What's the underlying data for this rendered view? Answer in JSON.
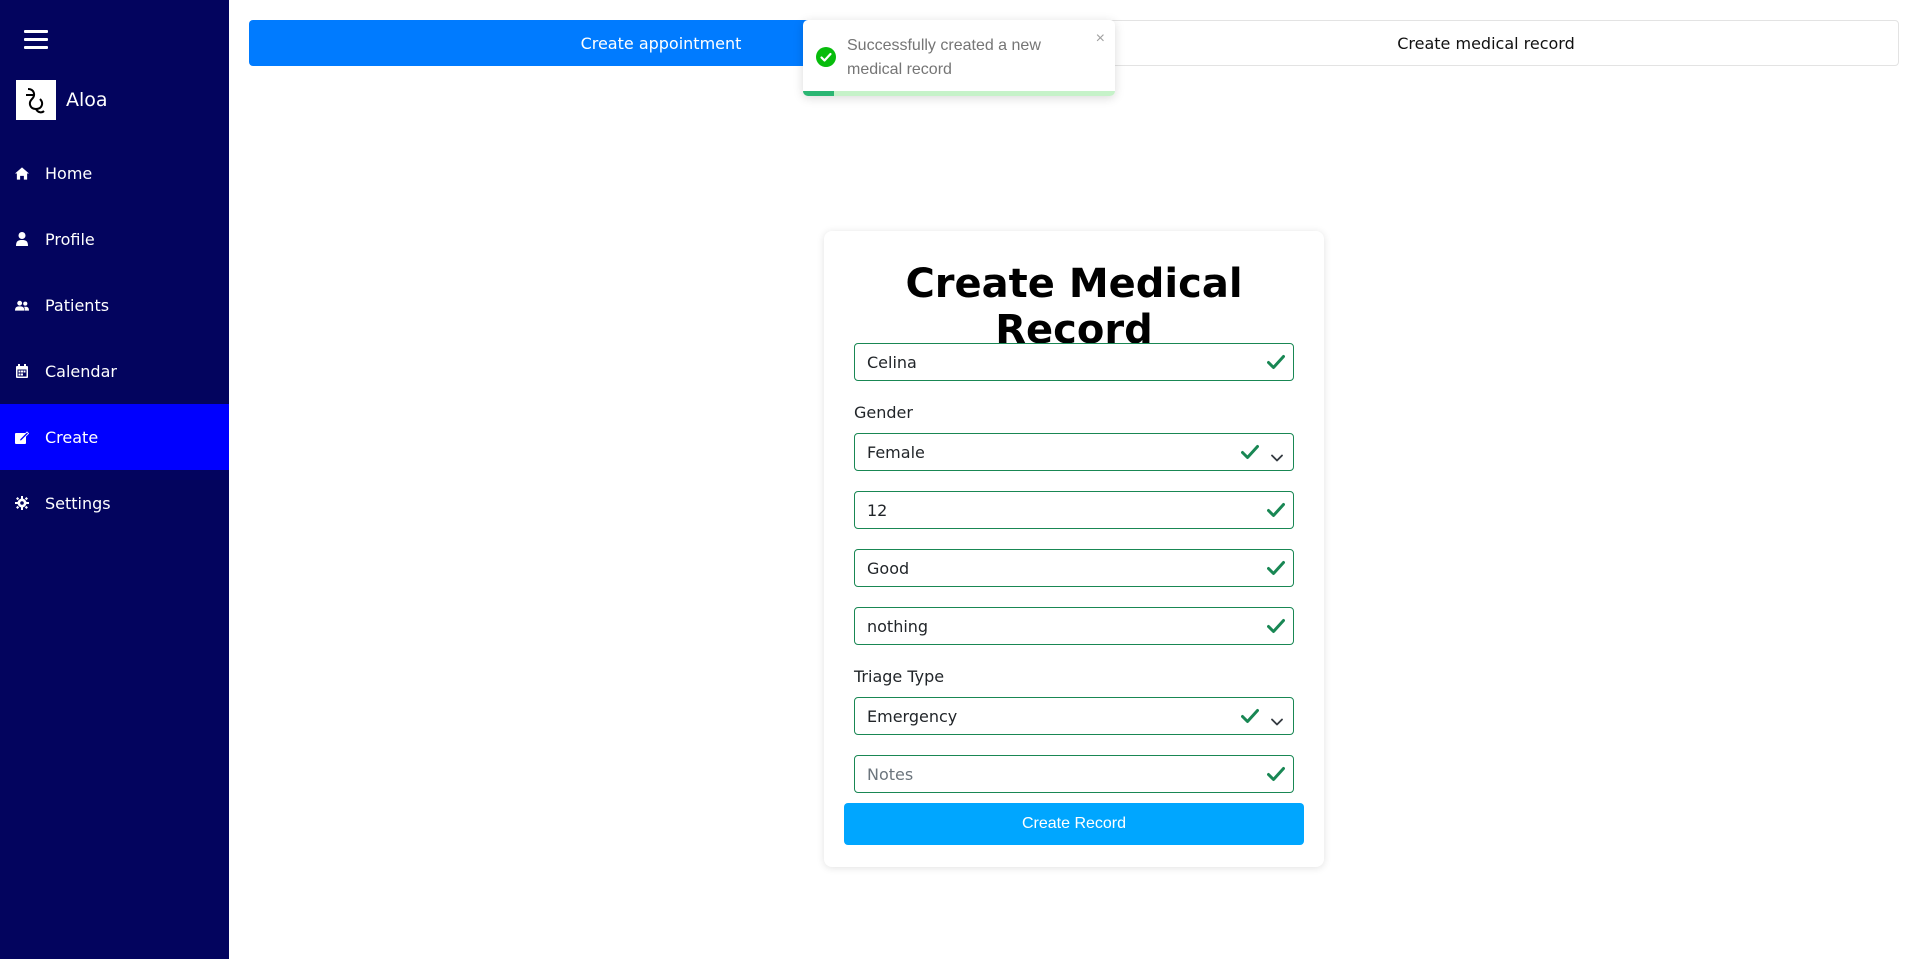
{
  "app": {
    "name": "Aloa"
  },
  "sidebar": {
    "items": [
      {
        "label": "Home",
        "icon": "home-icon"
      },
      {
        "label": "Profile",
        "icon": "user-icon"
      },
      {
        "label": "Patients",
        "icon": "users-icon"
      },
      {
        "label": "Calendar",
        "icon": "calendar-icon"
      },
      {
        "label": "Create",
        "icon": "edit-icon",
        "active": true
      },
      {
        "label": "Settings",
        "icon": "gear-icon"
      }
    ]
  },
  "tabs": [
    {
      "label": "Create appointment",
      "active": true
    },
    {
      "label": "Create medical record",
      "active": false
    }
  ],
  "toast": {
    "message": "Successfully created a new medical record",
    "close_label": "×",
    "progress": 0.1,
    "status": "success"
  },
  "form": {
    "title": "Create Medical Record",
    "name_value": "Celina",
    "gender_label": "Gender",
    "gender_value": "Female",
    "age_value": "12",
    "condition_value": "Good",
    "allergies_value": "nothing",
    "triage_label": "Triage Type",
    "triage_value": "Emergency",
    "notes_placeholder": "Notes",
    "submit_label": "Create Record"
  },
  "colors": {
    "sidebar_bg": "#03045e",
    "active_nav": "#0000ff",
    "primary": "#007bff",
    "submit": "#00a6ff",
    "valid": "#198754"
  }
}
